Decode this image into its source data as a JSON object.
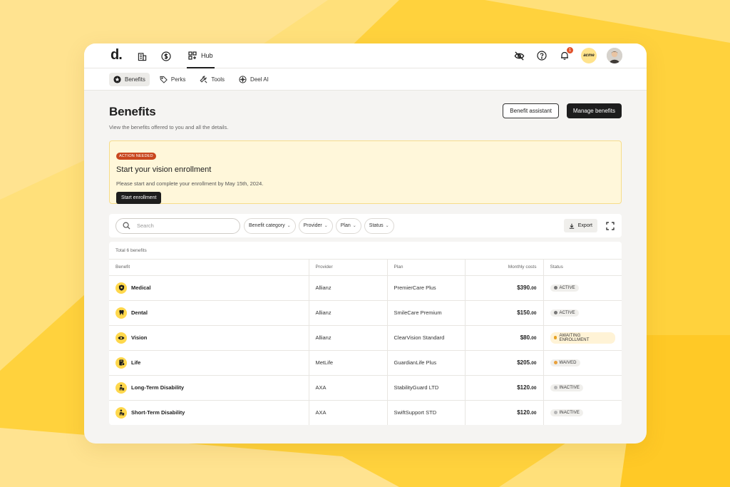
{
  "colors": {
    "accent": "#ffd84d",
    "dark": "#1d1d1d",
    "action_badge": "#c9471f",
    "alert_bg": "#fff7da",
    "status_active": "#777777",
    "status_awaiting": "#e7a325",
    "status_waived": "#e8a03c",
    "status_inactive": "#b5b5b5"
  },
  "topbar": {
    "logo": "d.",
    "hub_label": "Hub",
    "notification_count": "1",
    "org_label": "acme"
  },
  "subnav": {
    "items": [
      {
        "label": "Benefits",
        "icon": "star-badge-icon"
      },
      {
        "label": "Perks",
        "icon": "tag-icon"
      },
      {
        "label": "Tools",
        "icon": "wrench-icon"
      },
      {
        "label": "Deel AI",
        "icon": "ai-icon"
      }
    ]
  },
  "page": {
    "title": "Benefits",
    "subtitle": "View the benefits offered to you and all the details.",
    "assistant_button": "Benefit assistant",
    "manage_button": "Manage benefits"
  },
  "alert": {
    "badge": "ACTION NEEDED",
    "title": "Start your vision enrollment",
    "text": "Please start and complete your enrollment by May 15th, 2024.",
    "button": "Start enrollment"
  },
  "filters": {
    "search_placeholder": "Search",
    "pills": [
      "Benefit category",
      "Provider",
      "Plan",
      "Status"
    ],
    "export_label": "Export"
  },
  "table": {
    "total": "Total 6 benefits",
    "columns": [
      "Benefit",
      "Provider",
      "Plan",
      "Monthly costs",
      "Status"
    ],
    "rows": [
      {
        "benefit": "Medical",
        "icon": "shield-icon",
        "provider": "Allianz",
        "plan": "PremierCare Plus",
        "cost_main": "$390.",
        "cost_cents": "00",
        "status": "ACTIVE",
        "status_color": "#777777"
      },
      {
        "benefit": "Dental",
        "icon": "tooth-icon",
        "provider": "Allianz",
        "plan": "SmileCare Premium",
        "cost_main": "$150.",
        "cost_cents": "00",
        "status": "ACTIVE",
        "status_color": "#777777"
      },
      {
        "benefit": "Vision",
        "icon": "eye-icon",
        "provider": "Allianz",
        "plan": "ClearVision Standard",
        "cost_main": "$80.",
        "cost_cents": "00",
        "status": "AWAITING ENROLLMENT",
        "status_color": "#e7a325"
      },
      {
        "benefit": "Life",
        "icon": "life-icon",
        "provider": "MetLife",
        "plan": "GuardianLife Plus",
        "cost_main": "$205.",
        "cost_cents": "00",
        "status": "WAIVED",
        "status_color": "#e8a03c"
      },
      {
        "benefit": "Long-Term Disability",
        "icon": "person-icon",
        "provider": "AXA",
        "plan": "StabilityGuard LTD",
        "cost_main": "$120.",
        "cost_cents": "00",
        "status": "INACTIVE",
        "status_color": "#b5b5b5"
      },
      {
        "benefit": "Short-Term Disability",
        "icon": "person-icon",
        "provider": "AXA",
        "plan": "SwiftSupport STD",
        "cost_main": "$120.",
        "cost_cents": "00",
        "status": "INACTIVE",
        "status_color": "#b5b5b5"
      }
    ]
  }
}
